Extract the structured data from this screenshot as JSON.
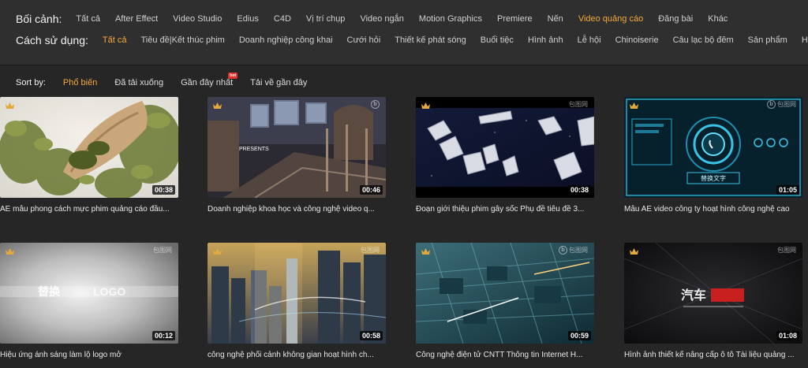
{
  "filters": {
    "context": {
      "label": "Bối cảnh:",
      "items": [
        "Tất cả",
        "After Effect",
        "Video Studio",
        "Edius",
        "C4D",
        "Vị trí chụp",
        "Video ngắn",
        "Motion Graphics",
        "Premiere",
        "Nến",
        "Video quảng cáo",
        "Đăng bài",
        "Khác"
      ],
      "active": "Video quảng cáo"
    },
    "usage": {
      "label": "Cách sử dụng:",
      "items": [
        "Tất cả",
        "Tiêu đề|Kết thúc phim",
        "Doanh nghiệp công khai",
        "Cưới hỏi",
        "Thiết kế phát sóng",
        "Buổi tiệc",
        "Hình ảnh",
        "Lễ hội",
        "Chinoiserie",
        "Câu lạc bộ đêm",
        "Sản phẩm"
      ],
      "active": "Tất cả",
      "more_label": "Hơn"
    }
  },
  "sort": {
    "label": "Sort by:",
    "options": [
      "Phổ biến",
      "Đã tải xuống",
      "Gần đây nhất",
      "Tải về gần đây"
    ],
    "active": "Phổ biến",
    "hot_badge": "hot"
  },
  "watermark": "包图网",
  "videos": [
    {
      "title": "AE mẫu phong cách mực phim quảng cáo đầu...",
      "duration": "00:38",
      "icon": "crown-icon"
    },
    {
      "title": "Doanh nghiệp khoa học và công nghệ video q...",
      "duration": "00:46",
      "icon": "crown-icon"
    },
    {
      "title": "Đoạn giới thiệu phim gây sốc Phụ đề tiêu đề 3...",
      "duration": "00:38",
      "icon": "crown-icon"
    },
    {
      "title": "Mẫu AE video công ty hoạt hình công nghệ cao",
      "duration": "01:05",
      "icon": "crown-icon"
    },
    {
      "title": "Hiệu ứng ánh sáng làm lộ logo mở",
      "duration": "00:12",
      "icon": "crown-icon"
    },
    {
      "title": "công nghệ phối cảnh không gian hoạt hình ch...",
      "duration": "00:58",
      "icon": "crown-icon"
    },
    {
      "title": "Công nghệ điện tử CNTT Thông tin Internet H...",
      "duration": "00:59",
      "icon": "crown-icon"
    },
    {
      "title": "Hình ảnh thiết kế nâng cấp ô tô Tài liệu quảng ...",
      "duration": "01:08",
      "icon": "crown-icon"
    }
  ],
  "thumb_text": {
    "presents": "PRESENTS",
    "logo": "LOGO",
    "hud": "替换文字",
    "car": "汽车"
  },
  "colors": {
    "accent": "#f3a93a",
    "background": "#262626",
    "panel": "#2f2f2f"
  }
}
